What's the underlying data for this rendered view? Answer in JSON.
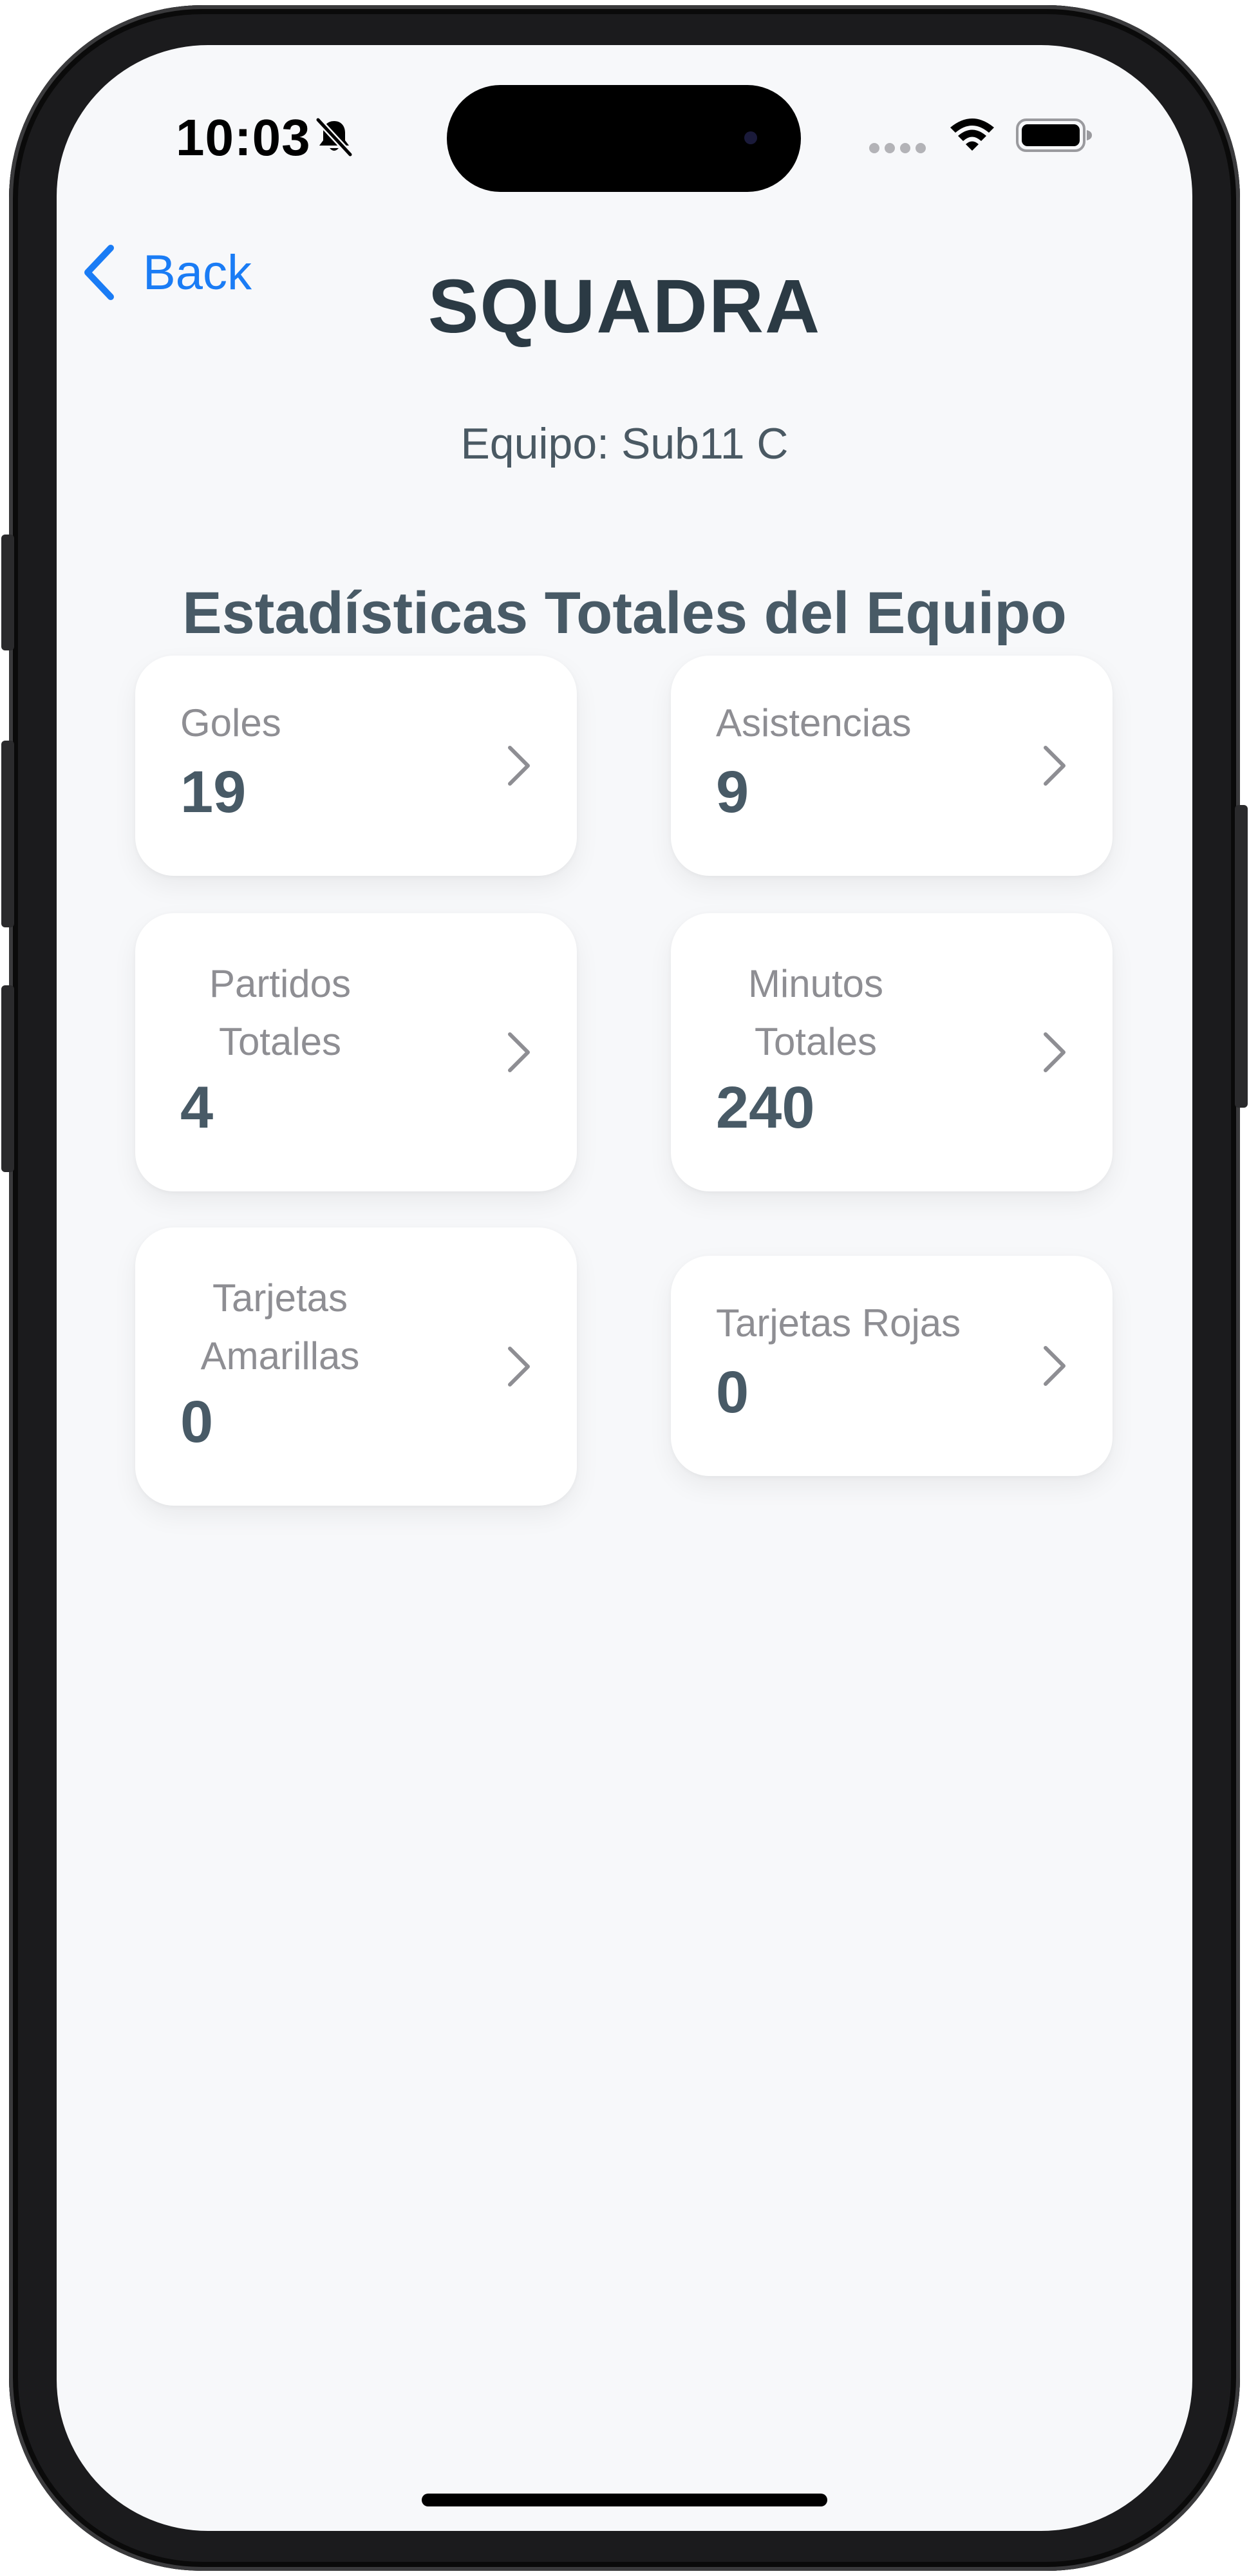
{
  "status_bar": {
    "time": "10:03"
  },
  "nav": {
    "back_label": "Back",
    "title": "SQUADRA"
  },
  "team": {
    "line": "Equipo: Sub11 C"
  },
  "stats": {
    "section_title": "Estadísticas Totales del Equipo",
    "cards": [
      {
        "label": "Goles",
        "value": "19"
      },
      {
        "label": "Asistencias",
        "value": "9"
      },
      {
        "label": "Partidos Totales",
        "value": "4"
      },
      {
        "label": "Minutos Totales",
        "value": "240"
      },
      {
        "label": "Tarjetas Amarillas",
        "value": "0"
      },
      {
        "label": "Tarjetas Rojas",
        "value": "0"
      }
    ]
  },
  "colors": {
    "accent": "#1a7cf5",
    "title": "#2b3a44",
    "value": "#485a66",
    "label": "#8e8e93",
    "background": "#f7f8fa",
    "card": "#ffffff"
  },
  "icons": {
    "back": "chevron-left-icon",
    "card_disclosure": "chevron-right-icon",
    "silent": "bell-slash-icon",
    "wifi": "wifi-icon",
    "battery": "battery-icon",
    "cellular": "cellular-icon"
  }
}
